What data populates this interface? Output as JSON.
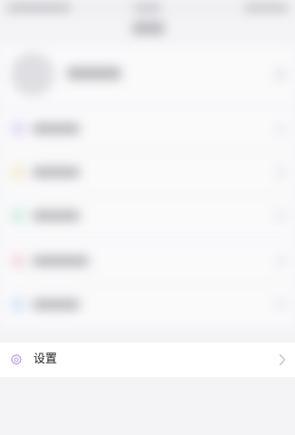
{
  "settings_row": {
    "label": "设置",
    "icon": "gear-icon",
    "chevron": "chevron-right-icon"
  },
  "colors": {
    "page_background": "#f4f4f7",
    "settings_icon": "#b59ae0",
    "chevron": "#c6c6cc"
  },
  "blurred_rows": [
    {
      "icon_color": "#d9c8f2"
    },
    {
      "icon_color": "#f3e6b8"
    },
    {
      "icon_color": "#bfe8d6"
    },
    {
      "icon_color": "#f5c9cf"
    },
    {
      "icon_color": "#c8dcf6"
    },
    {
      "icon_color": "#f4e4bd"
    }
  ]
}
